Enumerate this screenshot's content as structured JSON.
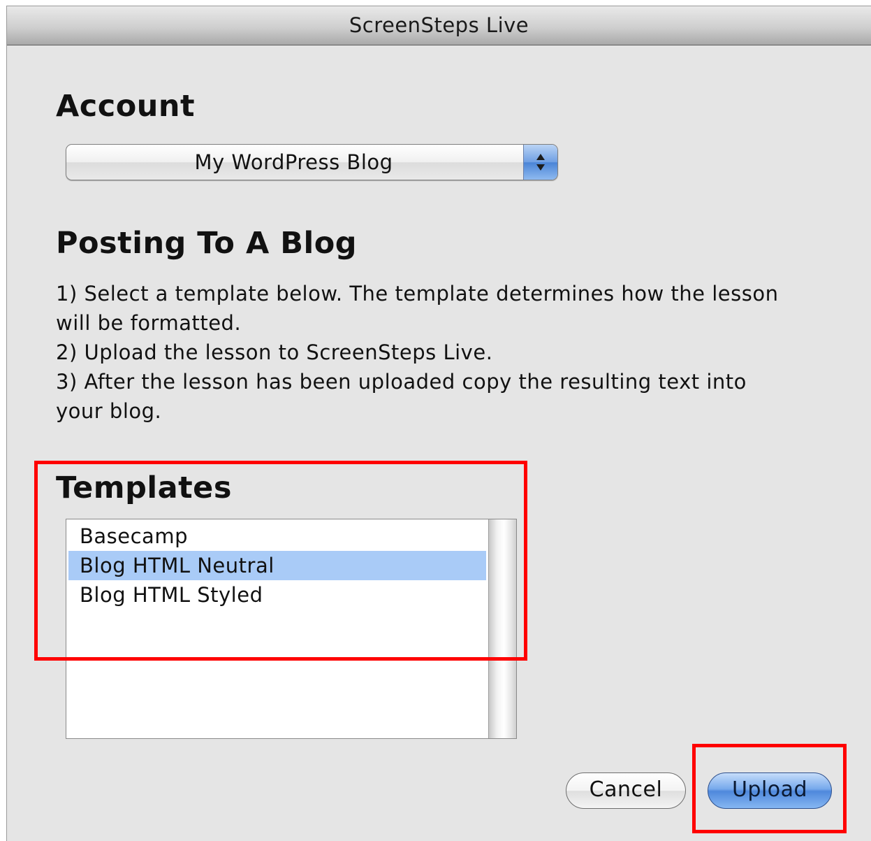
{
  "window": {
    "title": "ScreenSteps Live"
  },
  "account": {
    "heading": "Account",
    "selected": "My WordPress Blog"
  },
  "posting": {
    "heading": "Posting To A Blog",
    "lines": [
      "1) Select a template below. The template determines how the lesson",
      "will be formatted.",
      "2) Upload the lesson to ScreenSteps Live.",
      "3) After the lesson has been uploaded copy the resulting text into",
      "your blog."
    ]
  },
  "templates": {
    "heading": "Templates",
    "items": [
      "Basecamp",
      "Blog HTML Neutral",
      "Blog HTML Styled"
    ],
    "selected_index": 1
  },
  "buttons": {
    "cancel": "Cancel",
    "upload": "Upload"
  },
  "colors": {
    "highlight": "#ff0000",
    "selection": "#a9cbf7",
    "window_bg": "#e5e5e5"
  }
}
